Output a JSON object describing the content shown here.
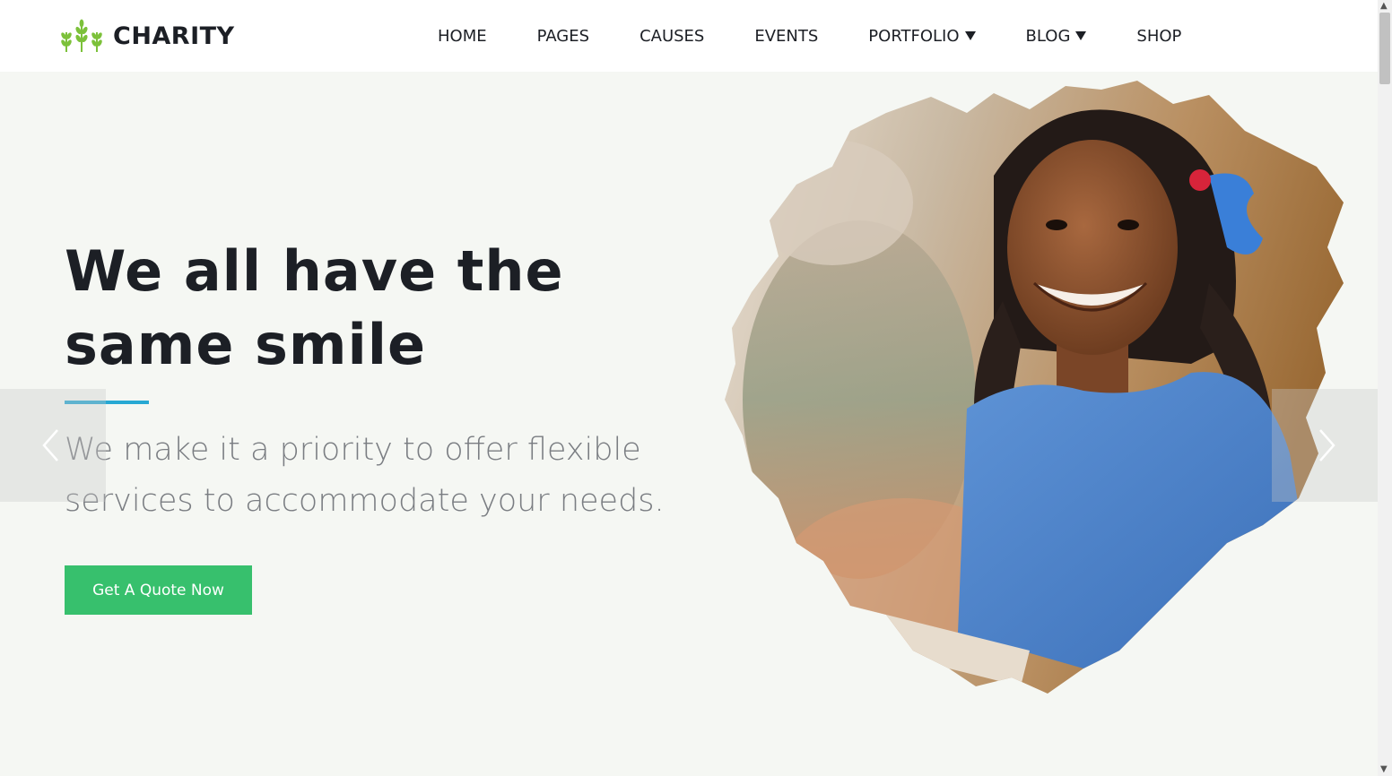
{
  "header": {
    "logo_text": "CHARITY",
    "logo_icon": "wheat-sprout-icon",
    "nav": [
      {
        "label": "HOME",
        "has_dropdown": false
      },
      {
        "label": "PAGES",
        "has_dropdown": false
      },
      {
        "label": "CAUSES",
        "has_dropdown": false
      },
      {
        "label": "EVENTS",
        "has_dropdown": false
      },
      {
        "label": "PORTFOLIO",
        "has_dropdown": true
      },
      {
        "label": "BLOG",
        "has_dropdown": true
      },
      {
        "label": "SHOP",
        "has_dropdown": false
      }
    ]
  },
  "hero": {
    "title_line1": "We all have the",
    "title_line2": "same smile",
    "subtitle_line1": "We make it a priority to offer flexible",
    "subtitle_line2": "services to accommodate your needs.",
    "cta_label": "Get A Quote Now",
    "prev_icon": "chevron-left-icon",
    "next_icon": "chevron-right-icon",
    "image_subject": "smiling girl in blue dress with brush-stroke mask"
  },
  "colors": {
    "accent_green": "#37c06d",
    "underline_blue": "#27a8d3",
    "logo_green": "#7cc13a",
    "text_dark": "#1c1f25",
    "text_muted": "#7a7d82",
    "background": "#f5f7f3"
  }
}
